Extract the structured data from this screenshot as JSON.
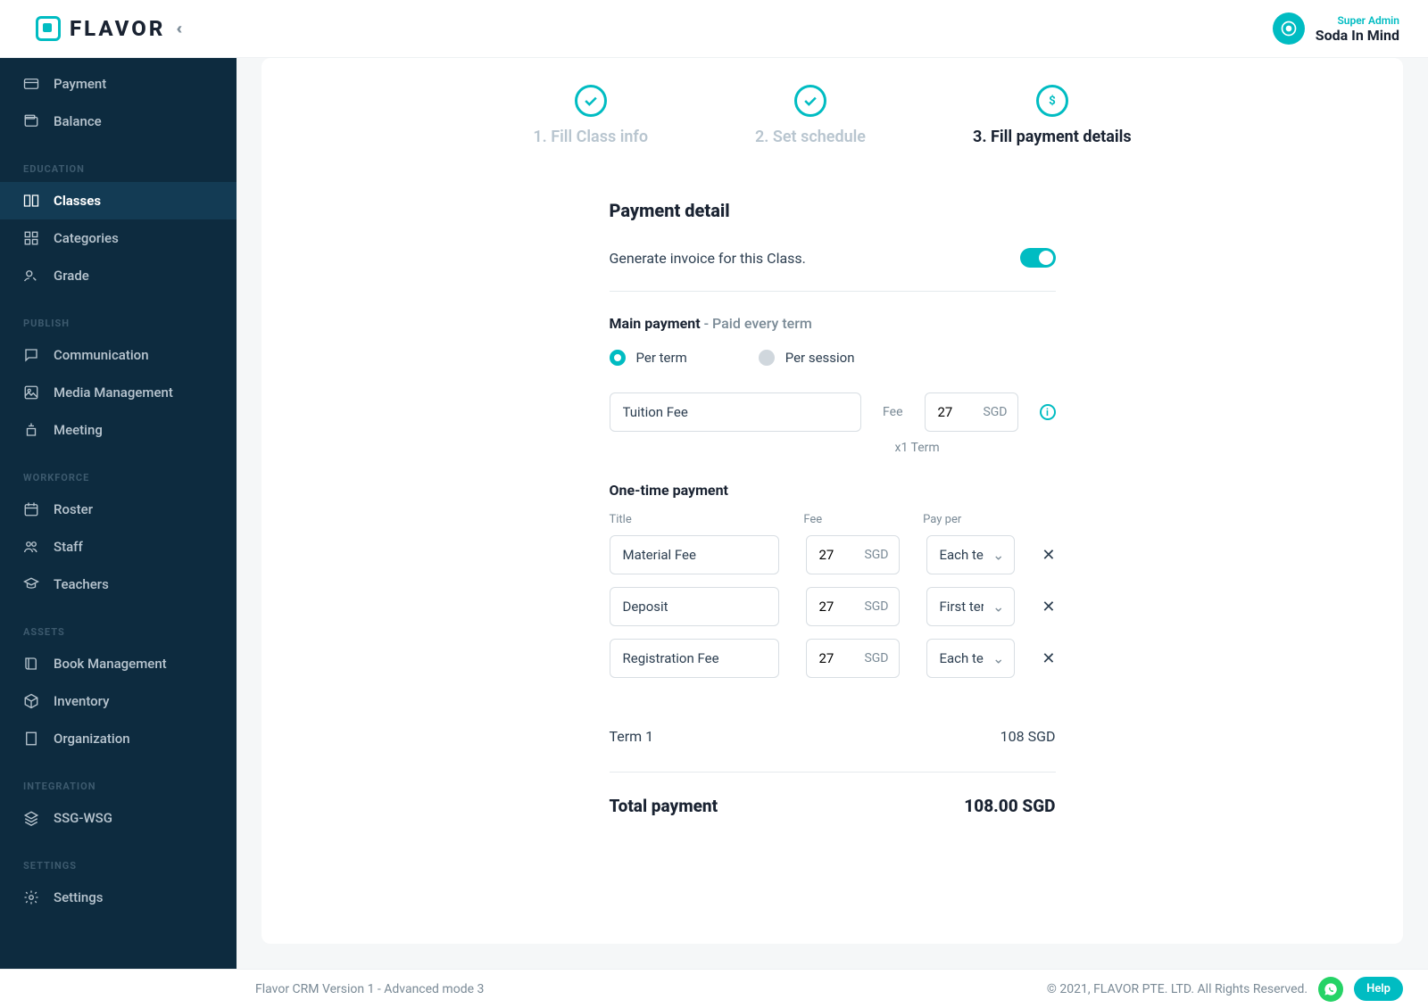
{
  "brand": {
    "name": "FLAVOR"
  },
  "user": {
    "role": "Super Admin",
    "name": "Soda In Mind"
  },
  "sidebar": {
    "top": [
      {
        "label": "Payment",
        "icon": "card"
      },
      {
        "label": "Balance",
        "icon": "wallet"
      }
    ],
    "sections": [
      {
        "heading": "EDUCATION",
        "items": [
          {
            "label": "Classes",
            "icon": "book-open",
            "active": true
          },
          {
            "label": "Categories",
            "icon": "grid"
          },
          {
            "label": "Grade",
            "icon": "grade"
          }
        ]
      },
      {
        "heading": "PUBLISH",
        "items": [
          {
            "label": "Communication",
            "icon": "chat"
          },
          {
            "label": "Media Management",
            "icon": "image"
          },
          {
            "label": "Meeting",
            "icon": "podium"
          }
        ]
      },
      {
        "heading": "WORKFORCE",
        "items": [
          {
            "label": "Roster",
            "icon": "calendar"
          },
          {
            "label": "Staff",
            "icon": "people"
          },
          {
            "label": "Teachers",
            "icon": "teacher"
          }
        ]
      },
      {
        "heading": "ASSETS",
        "items": [
          {
            "label": "Book Management",
            "icon": "book"
          },
          {
            "label": "Inventory",
            "icon": "package"
          },
          {
            "label": "Organization",
            "icon": "building"
          }
        ]
      },
      {
        "heading": "INTEGRATION",
        "items": [
          {
            "label": "SSG-WSG",
            "icon": "layers"
          }
        ]
      },
      {
        "heading": "SETTINGS",
        "items": [
          {
            "label": "Settings",
            "icon": "gear"
          }
        ]
      }
    ]
  },
  "stepper": [
    {
      "label": "1. Fill Class info",
      "state": "done"
    },
    {
      "label": "2. Set schedule",
      "state": "done"
    },
    {
      "label": "3. Fill payment details",
      "state": "active"
    }
  ],
  "payment": {
    "section_title": "Payment detail",
    "invoice_toggle_label": "Generate invoice for this Class.",
    "invoice_enabled": true,
    "main": {
      "title": "Main payment",
      "meta": " - Paid every term",
      "mode_options": [
        "Per term",
        "Per session"
      ],
      "mode_selected": "Per term",
      "fee_title": "Tuition Fee",
      "fee_label": "Fee",
      "fee_amount": "27",
      "currency": "SGD",
      "term_note": "x1 Term"
    },
    "onetime": {
      "title": "One-time payment",
      "headers": [
        "Title",
        "Fee",
        "Pay per"
      ],
      "rows": [
        {
          "title": "Material Fee",
          "amount": "27",
          "currency": "SGD",
          "pay_per": "Each term"
        },
        {
          "title": "Deposit",
          "amount": "27",
          "currency": "SGD",
          "pay_per": "First term only"
        },
        {
          "title": "Registration Fee",
          "amount": "27",
          "currency": "SGD",
          "pay_per": "Each term"
        }
      ]
    },
    "totals": {
      "rows": [
        {
          "label": "Term 1",
          "value": "108 SGD"
        }
      ],
      "final_label": "Total payment",
      "final_value": "108.00 SGD"
    }
  },
  "footer": {
    "version": "Flavor CRM Version 1 - Advanced mode 3",
    "copyright": "© 2021, FLAVOR PTE. LTD. All Rights Reserved.",
    "help": "Help"
  }
}
